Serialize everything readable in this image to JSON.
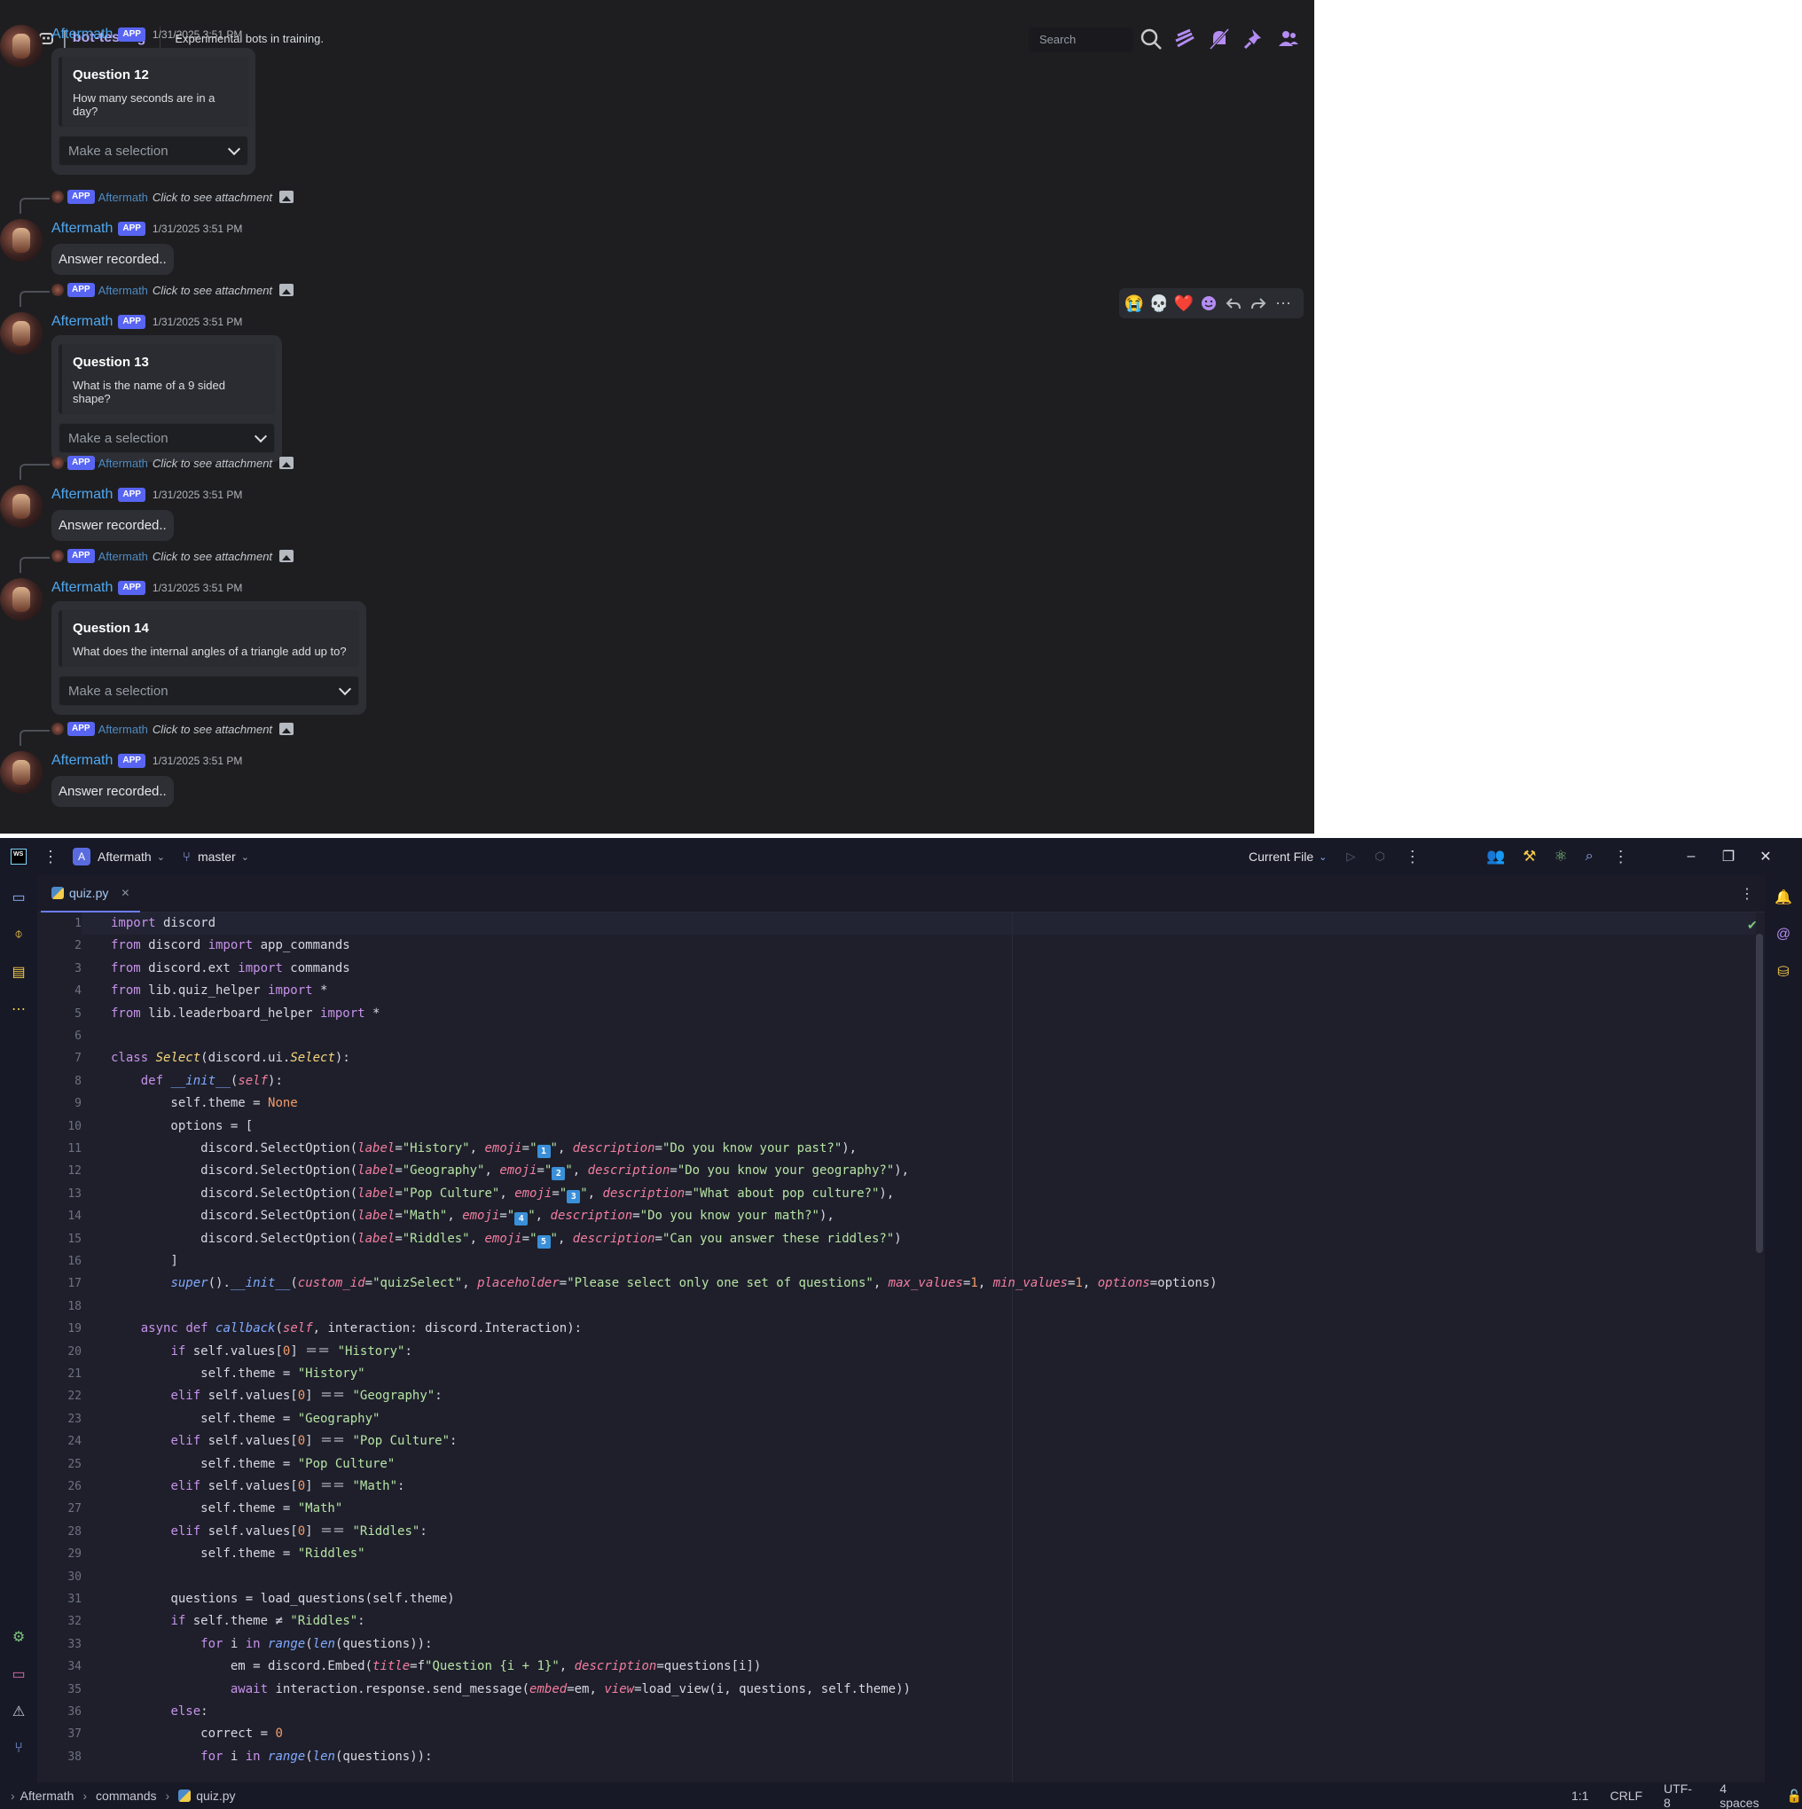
{
  "discord": {
    "channel_name": "bot-testing",
    "topic": "Experimental bots in training.",
    "search_placeholder": "Search",
    "reaction_emojis": [
      "😭",
      "💀",
      "❤️"
    ],
    "messages": [
      {
        "kind": "embed",
        "reply": null,
        "user": "Aftermath",
        "tag": "APP",
        "time": "1/31/2025 3:51 PM",
        "title": "Question 12",
        "desc": "How many seconds are in a day?",
        "select": "Make a selection"
      },
      {
        "kind": "simple",
        "reply": {
          "tag": "APP",
          "name": "Aftermath",
          "text": "Click to see attachment"
        },
        "user": "Aftermath",
        "tag": "APP",
        "time": "1/31/2025 3:51 PM",
        "text": "Answer recorded.."
      },
      {
        "kind": "embed",
        "reply": {
          "tag": "APP",
          "name": "Aftermath",
          "text": "Click to see attachment"
        },
        "user": "Aftermath",
        "tag": "APP",
        "time": "1/31/2025 3:51 PM",
        "title": "Question 13",
        "desc": "What is the name of a 9 sided shape?",
        "select": "Make a selection"
      },
      {
        "kind": "simple",
        "reply": {
          "tag": "APP",
          "name": "Aftermath",
          "text": "Click to see attachment"
        },
        "user": "Aftermath",
        "tag": "APP",
        "time": "1/31/2025 3:51 PM",
        "text": "Answer recorded.."
      },
      {
        "kind": "embed",
        "reply": {
          "tag": "APP",
          "name": "Aftermath",
          "text": "Click to see attachment"
        },
        "user": "Aftermath",
        "tag": "APP",
        "time": "1/31/2025 3:51 PM",
        "title": "Question 14",
        "desc": "What does the internal angles of a triangle add up to?",
        "select": "Make a selection"
      },
      {
        "kind": "simple",
        "reply": {
          "tag": "APP",
          "name": "Aftermath",
          "text": "Click to see attachment"
        },
        "user": "Aftermath",
        "tag": "APP",
        "time": "1/31/2025 3:51 PM",
        "text": "Answer recorded.."
      }
    ]
  },
  "ide": {
    "project": "Aftermath",
    "project_initial": "A",
    "branch": "master",
    "run_config": "Current File",
    "tab": "quiz.py",
    "breadcrumb": [
      "Aftermath",
      "commands",
      "quiz.py"
    ],
    "status": {
      "position": "1:1",
      "line_sep": "CRLF",
      "encoding": "UTF-8",
      "indent": "4 spaces"
    },
    "code_lines": [
      "import discord",
      "from discord import app_commands",
      "from discord.ext import commands",
      "from lib.quiz_helper import *",
      "from lib.leaderboard_helper import *",
      "",
      "class Select(discord.ui.Select):",
      "    def __init__(self):",
      "        self.theme = None",
      "        options = [",
      "            discord.SelectOption(label=\"History\", emoji=\"1️⃣\", description=\"Do you know your past?\"),",
      "            discord.SelectOption(label=\"Geography\", emoji=\"2️⃣\", description=\"Do you know your geography?\"),",
      "            discord.SelectOption(label=\"Pop Culture\", emoji=\"3️⃣\", description=\"What about pop culture?\"),",
      "            discord.SelectOption(label=\"Math\", emoji=\"4️⃣\", description=\"Do you know your math?\"),",
      "            discord.SelectOption(label=\"Riddles\", emoji=\"5️⃣\", description=\"Can you answer these riddles?\")",
      "        ]",
      "        super().__init__(custom_id=\"quizSelect\", placeholder=\"Please select only one set of questions\", max_values=1, min_values=1, options=options)",
      "",
      "    async def callback(self, interaction: discord.Interaction):",
      "        if self.values[0] == \"History\":",
      "            self.theme = \"History\"",
      "        elif self.values[0] == \"Geography\":",
      "            self.theme = \"Geography\"",
      "        elif self.values[0] == \"Pop Culture\":",
      "            self.theme = \"Pop Culture\"",
      "        elif self.values[0] == \"Math\":",
      "            self.theme = \"Math\"",
      "        elif self.values[0] == \"Riddles\":",
      "            self.theme = \"Riddles\"",
      "",
      "        questions = load_questions(self.theme)",
      "        if self.theme != \"Riddles\":",
      "            for i in range(len(questions)):",
      "                em = discord.Embed(title=f\"Question {i + 1}\", description=questions[i])",
      "                await interaction.response.send_message(embed=em, view=load_view(i, questions, self.theme))",
      "        else:",
      "            correct = 0",
      "            for i in range(len(questions)):"
    ]
  },
  "icons": [
    "hash-icon",
    "search-icon",
    "threads-icon",
    "mute-icon",
    "pin-icon",
    "members-icon",
    "reply-icon",
    "forward-icon",
    "more-icon",
    "image-icon",
    "git-branch-icon",
    "settings-icon",
    "terminal-icon",
    "bell-icon"
  ]
}
